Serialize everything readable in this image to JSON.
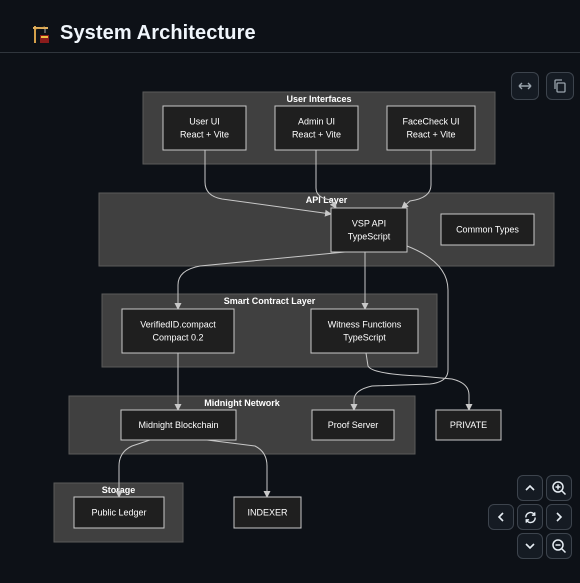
{
  "header": {
    "title": "System Architecture",
    "icon": "construction-icon"
  },
  "toolbar": {
    "expand_icon": "horizontal-arrows-icon",
    "copy_icon": "copy-icon"
  },
  "diagram": {
    "clusters": [
      {
        "id": "ui",
        "label": "User Interfaces"
      },
      {
        "id": "api",
        "label": "API Layer"
      },
      {
        "id": "sc",
        "label": "Smart Contract Layer"
      },
      {
        "id": "net",
        "label": "Midnight Network"
      },
      {
        "id": "storage",
        "label": "Storage"
      }
    ],
    "nodes": [
      {
        "id": "user_ui",
        "lines": [
          "User UI",
          "React + Vite"
        ]
      },
      {
        "id": "admin_ui",
        "lines": [
          "Admin UI",
          "React + Vite"
        ]
      },
      {
        "id": "facecheck_ui",
        "lines": [
          "FaceCheck UI",
          "React + Vite"
        ]
      },
      {
        "id": "vsp_api",
        "lines": [
          "VSP API",
          "TypeScript"
        ]
      },
      {
        "id": "common_types",
        "lines": [
          "Common Types"
        ]
      },
      {
        "id": "verifiedid",
        "lines": [
          "VerifiedID.compact",
          "Compact 0.2"
        ]
      },
      {
        "id": "witness",
        "lines": [
          "Witness Functions",
          "TypeScript"
        ]
      },
      {
        "id": "blockchain",
        "lines": [
          "Midnight Blockchain"
        ]
      },
      {
        "id": "proof_server",
        "lines": [
          "Proof Server"
        ]
      },
      {
        "id": "private",
        "lines": [
          "PRIVATE"
        ]
      },
      {
        "id": "public_ledger",
        "lines": [
          "Public Ledger"
        ]
      },
      {
        "id": "indexer",
        "lines": [
          "INDEXER"
        ]
      }
    ],
    "edges": [
      {
        "from": "user_ui",
        "to": "vsp_api"
      },
      {
        "from": "admin_ui",
        "to": "vsp_api"
      },
      {
        "from": "facecheck_ui",
        "to": "vsp_api"
      },
      {
        "from": "vsp_api",
        "to": "verifiedid"
      },
      {
        "from": "vsp_api",
        "to": "witness"
      },
      {
        "from": "vsp_api",
        "to": "proof_server"
      },
      {
        "from": "verifiedid",
        "to": "blockchain"
      },
      {
        "from": "witness",
        "to": "private"
      },
      {
        "from": "blockchain",
        "to": "public_ledger"
      },
      {
        "from": "blockchain",
        "to": "indexer"
      }
    ]
  },
  "controls": {
    "zoom_in_icon": "zoom-in-icon",
    "zoom_out_icon": "zoom-out-icon",
    "pan_up_icon": "chevron-up-icon",
    "pan_down_icon": "chevron-down-icon",
    "pan_left_icon": "chevron-left-icon",
    "pan_right_icon": "chevron-right-icon",
    "reset_icon": "reset-icon"
  }
}
